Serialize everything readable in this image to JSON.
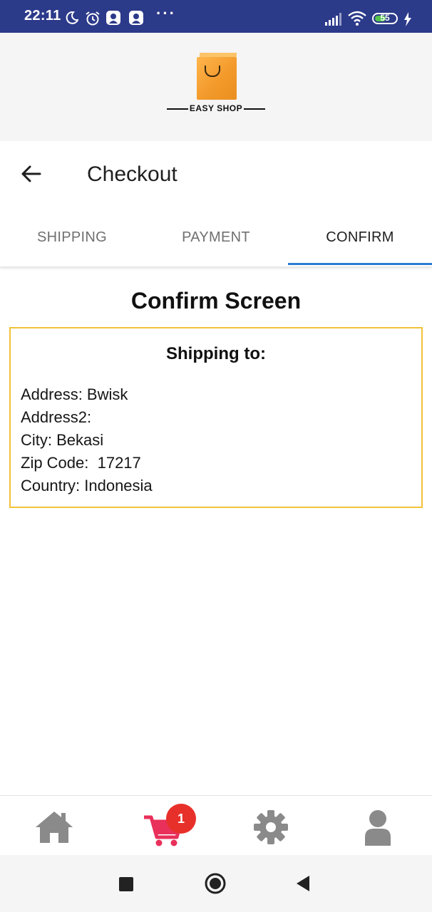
{
  "status_bar": {
    "time": "22:11",
    "more_dots": "···",
    "battery_level": "55",
    "battery_fraction": 0.55
  },
  "brand": {
    "logo_text": "EASY SHOP",
    "bag_color": "#f39a2c"
  },
  "header": {
    "title": "Checkout",
    "back_icon": "arrow-left-icon"
  },
  "tabs": [
    {
      "label": "SHIPPING",
      "active": false
    },
    {
      "label": "PAYMENT",
      "active": false
    },
    {
      "label": "CONFIRM",
      "active": true
    }
  ],
  "accent_color": "#2a7bd1",
  "confirm": {
    "title": "Confirm Screen",
    "box_border_color": "#f2c23a",
    "shipping_heading": "Shipping to:",
    "lines": [
      "Address: Bwisk",
      "Address2: ",
      "City: Bekasi",
      "Zip Code:  17217",
      "Country: Indonesia"
    ]
  },
  "bottom_nav": {
    "items": [
      "home-icon",
      "cart-icon",
      "settings-icon",
      "user-icon"
    ],
    "cart_badge": "1",
    "cart_color": "#e8305a",
    "badge_color": "#e8302b"
  },
  "system_nav": {
    "buttons": [
      "recent-apps-icon",
      "home-circle-icon",
      "back-triangle-icon"
    ]
  }
}
